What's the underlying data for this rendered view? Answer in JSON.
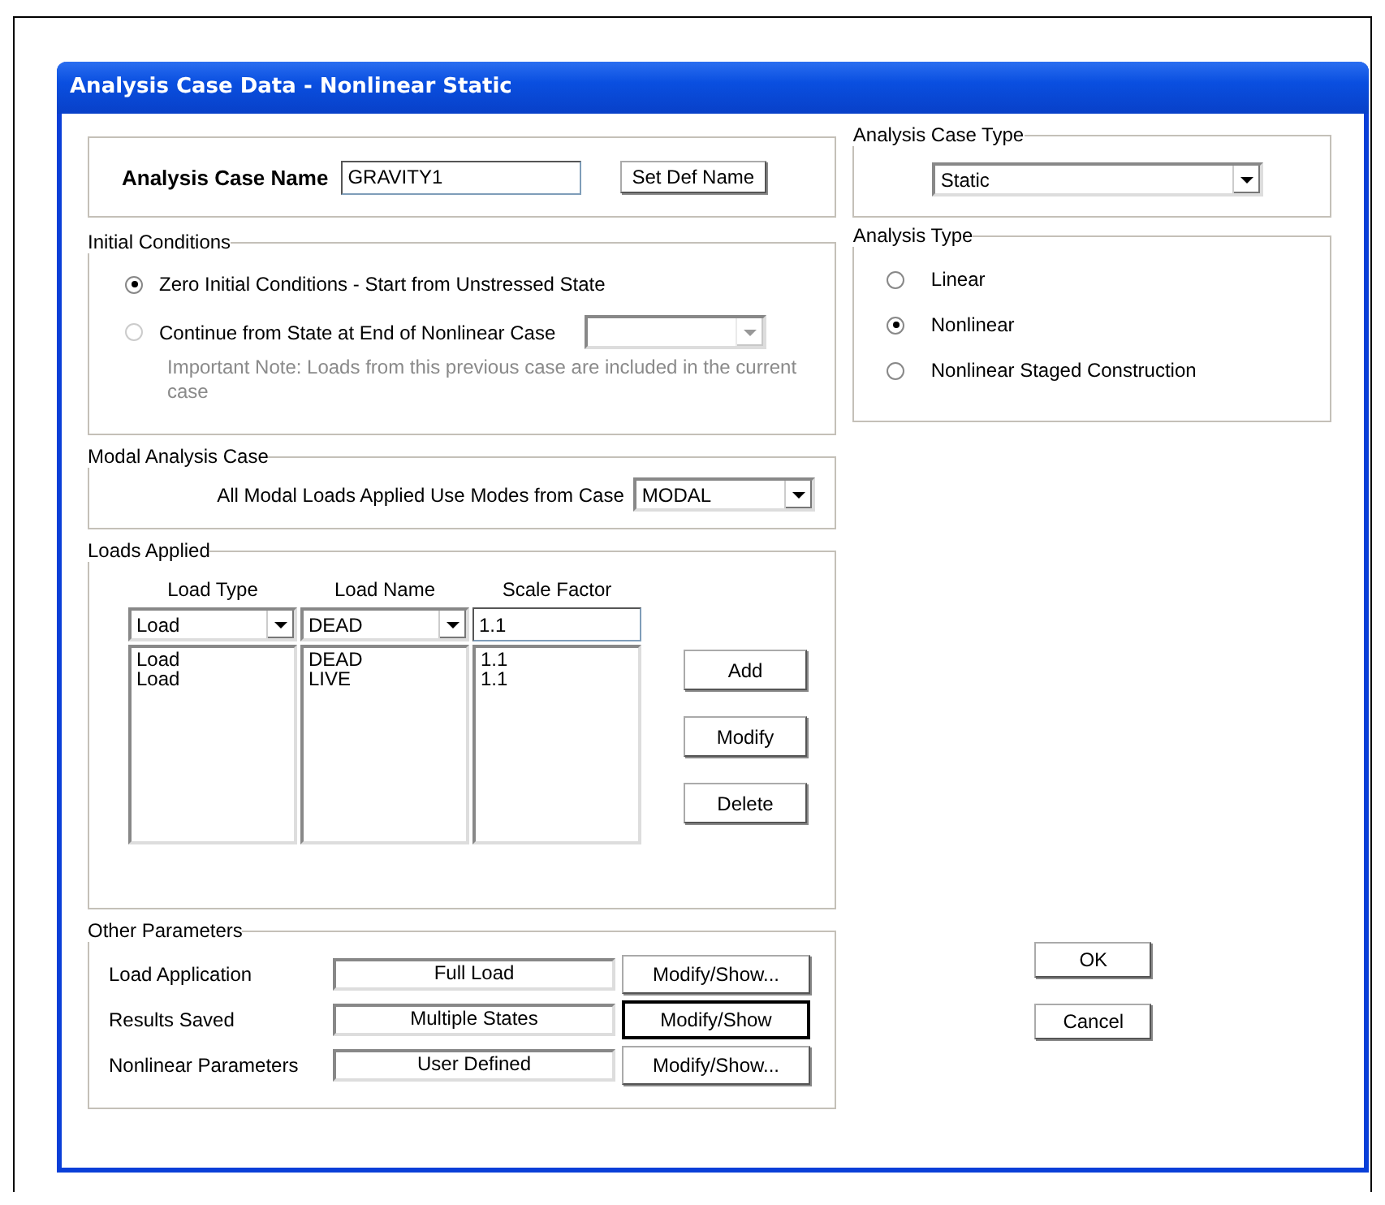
{
  "window": {
    "title": "Analysis Case Data - Nonlinear Static"
  },
  "case_name": {
    "label": "Analysis Case Name",
    "value": "GRAVITY1",
    "button": "Set Def Name"
  },
  "initial_conditions": {
    "title": "Initial Conditions",
    "options": [
      {
        "label": "Zero Initial Conditions - Start from Unstressed State",
        "selected": true
      },
      {
        "label": "Continue from State at End of Nonlinear Case",
        "selected": false
      }
    ],
    "case_select": {
      "disabled": true
    },
    "note": "Important Note:  Loads from this previous case are included in the current case"
  },
  "modal_case": {
    "title": "Modal Analysis Case",
    "label": "All Modal Loads Applied Use Modes from Case",
    "value": "MODAL"
  },
  "loads_applied": {
    "title": "Loads Applied",
    "columns": [
      "Load Type",
      "Load Name",
      "Scale Factor"
    ],
    "entry": {
      "load_type": "Load",
      "load_name": "DEAD",
      "scale_factor": "1.1"
    },
    "rows": [
      {
        "load_type": "Load",
        "load_name": "DEAD",
        "scale_factor": "1.1"
      },
      {
        "load_type": "Load",
        "load_name": "LIVE",
        "scale_factor": "1.1"
      }
    ],
    "buttons": [
      "Add",
      "Modify",
      "Delete"
    ]
  },
  "other_parameters": {
    "title": "Other Parameters",
    "rows": [
      {
        "label": "Load Application",
        "value": "Full Load",
        "button": "Modify/Show...",
        "focused": false
      },
      {
        "label": "Results Saved",
        "value": "Multiple States",
        "button": "Modify/Show",
        "focused": true
      },
      {
        "label": "Nonlinear Parameters",
        "value": "User Defined",
        "button": "Modify/Show...",
        "focused": false
      }
    ]
  },
  "analysis_case_type": {
    "title": "Analysis Case Type",
    "value": "Static"
  },
  "analysis_type": {
    "title": "Analysis Type",
    "options": [
      {
        "label": "Linear",
        "selected": false
      },
      {
        "label": "Nonlinear",
        "selected": true
      },
      {
        "label": "Nonlinear Staged Construction",
        "selected": false
      }
    ]
  },
  "buttons": [
    "OK",
    "Cancel"
  ]
}
